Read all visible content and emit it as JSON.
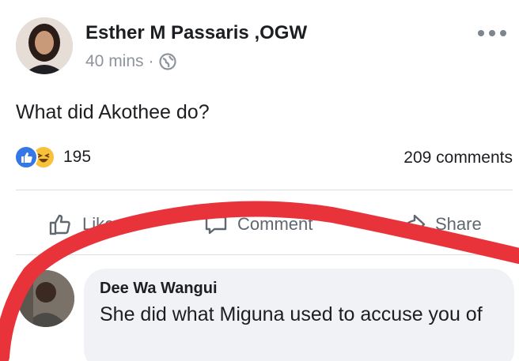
{
  "post": {
    "author": "Esther M Passaris ,OGW",
    "time": "40 mins",
    "separator": "·",
    "text": "What did Akothee do?",
    "reaction_count": "195",
    "comments_label": "209 comments"
  },
  "actions": {
    "like": "Like",
    "comment": "Comment",
    "share": "Share"
  },
  "comment": {
    "author": "Dee Wa Wangui",
    "text": "She did what Miguna used to accuse you of"
  },
  "icons": {
    "globe": "globe-icon",
    "more": "more-options-icon",
    "like_reaction": "like-reaction-icon",
    "haha_reaction": "haha-reaction-icon",
    "like_action": "thumbs-up-icon",
    "comment_action": "speech-bubble-icon",
    "share_action": "share-arrow-icon"
  },
  "colors": {
    "accent_blue": "#3578e5",
    "haha_yellow": "#f7c13a",
    "annotation_red": "#e8333a",
    "muted_text": "#8d949e",
    "bubble_bg": "#f0f2f5"
  }
}
